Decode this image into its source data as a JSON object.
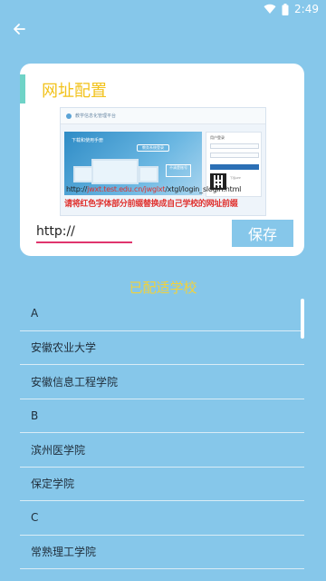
{
  "status_bar": {
    "time": "2:49",
    "wifi_icon": "wifi-icon",
    "battery_icon": "battery-icon"
  },
  "toolbar": {
    "back_icon": "arrow-left-icon"
  },
  "card": {
    "title": "网址配置",
    "preview": {
      "header_text": "教学信息化管理平台",
      "banner_title": "下载和使用手册",
      "banner_box": "教务系统登录",
      "banner_tag": "不清楚账号",
      "login_head": "用户登录",
      "qr_caption": "下载APP",
      "url_prefix": "http://",
      "url_highlight": "jwxt.test.edu.cn/jwglxt",
      "url_suffix": "/xtgl/login_slogin.html",
      "note": "请将红色字体部分前缀替换成自己学校的网址前缀"
    },
    "url_input": {
      "value": "http://",
      "placeholder": ""
    },
    "save_label": "保存"
  },
  "schools_section": {
    "title": "已配适学校",
    "items": [
      {
        "label": "A"
      },
      {
        "label": "安徽农业大学"
      },
      {
        "label": "安徽信息工程学院"
      },
      {
        "label": "B"
      },
      {
        "label": "滨州医学院"
      },
      {
        "label": "保定学院"
      },
      {
        "label": "C"
      },
      {
        "label": "常熟理工学院"
      },
      {
        "label": "C"
      }
    ]
  },
  "colors": {
    "background": "#86c7ea",
    "title_yellow": "#f2c21a",
    "accent_teal": "#6fd3c7",
    "input_underline": "#e0356d",
    "note_red": "#e0322f"
  }
}
